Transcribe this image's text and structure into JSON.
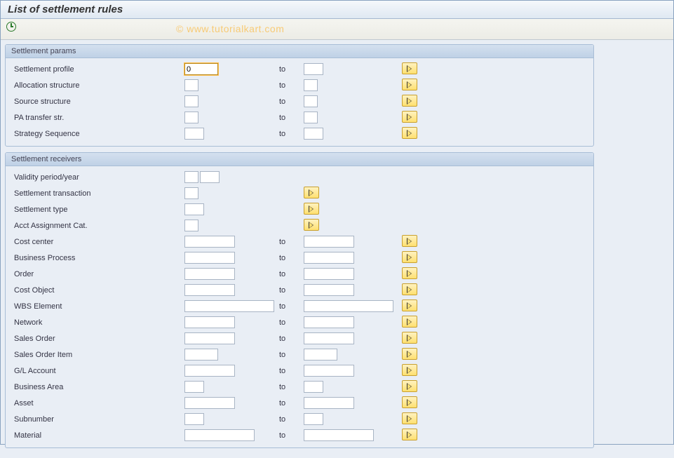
{
  "window_title": "List of settlement rules",
  "watermark": "© www.tutorialkart.com",
  "to_label": "to",
  "group_params": {
    "header": "Settlement params",
    "rows": {
      "settlement_profile": {
        "label": "Settlement profile",
        "from": "0",
        "to": ""
      },
      "allocation_structure": {
        "label": "Allocation structure",
        "from": "",
        "to": ""
      },
      "source_structure": {
        "label": "Source structure",
        "from": "",
        "to": ""
      },
      "pa_transfer_str": {
        "label": "PA transfer str.",
        "from": "",
        "to": ""
      },
      "strategy_sequence": {
        "label": "Strategy Sequence",
        "from": "",
        "to": ""
      }
    }
  },
  "group_receivers": {
    "header": "Settlement receivers",
    "rows": {
      "validity_period_year": {
        "label": "Validity period/year",
        "from1": "",
        "from2": ""
      },
      "settlement_transaction": {
        "label": "Settlement transaction",
        "from": ""
      },
      "settlement_type": {
        "label": "Settlement type",
        "from": ""
      },
      "acct_assignment_cat": {
        "label": "Acct Assignment Cat.",
        "from": ""
      },
      "cost_center": {
        "label": "Cost center",
        "from": "",
        "to": ""
      },
      "business_process": {
        "label": "Business Process",
        "from": "",
        "to": ""
      },
      "order": {
        "label": "Order",
        "from": "",
        "to": ""
      },
      "cost_object": {
        "label": "Cost Object",
        "from": "",
        "to": ""
      },
      "wbs_element": {
        "label": "WBS Element",
        "from": "",
        "to": ""
      },
      "network": {
        "label": "Network",
        "from": "",
        "to": ""
      },
      "sales_order": {
        "label": "Sales Order",
        "from": "",
        "to": ""
      },
      "sales_order_item": {
        "label": "Sales Order Item",
        "from": "",
        "to": ""
      },
      "gl_account": {
        "label": "G/L Account",
        "from": "",
        "to": ""
      },
      "business_area": {
        "label": "Business Area",
        "from": "",
        "to": ""
      },
      "asset": {
        "label": "Asset",
        "from": "",
        "to": ""
      },
      "subnumber": {
        "label": "Subnumber",
        "from": "",
        "to": ""
      },
      "material": {
        "label": "Material",
        "from": "",
        "to": ""
      }
    }
  }
}
